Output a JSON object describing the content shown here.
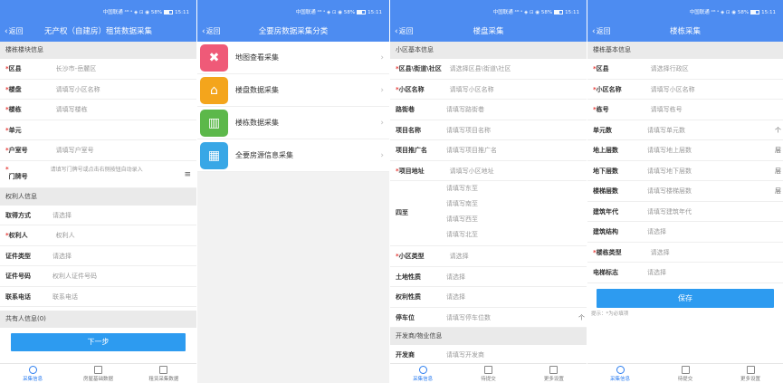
{
  "colors": {
    "header": "#4d8cf1",
    "button": "#2d9bf0",
    "section_bg": "#eaeaea",
    "required": "#e53935"
  },
  "status_text": "中国联通 ⁴ᴳ ᵃ ◈ ⊡ ◉ 58%",
  "status_time": "15:11",
  "screen1": {
    "back": "返回",
    "title": "无产权（自建房）租赁数据采集",
    "sec1": "楼栋楼块信息",
    "rows": [
      {
        "req": "*",
        "label": "区县",
        "value": "长沙市-岳麓区"
      },
      {
        "req": "*",
        "label": "楼盘",
        "value": "请填写小区名称"
      },
      {
        "req": "*",
        "label": "楼栋",
        "value": "请填写楼栋"
      },
      {
        "req": "*",
        "label": "单元",
        "value": ""
      },
      {
        "req": "*",
        "label": "户室号",
        "value": "请填写户室号"
      }
    ],
    "door_req": "*",
    "door_label": "门牌号",
    "door_value": "请填写门牌号或点击右侧按钮自动录入",
    "sec2": "权利人信息",
    "rows2": [
      {
        "req": "",
        "label": "取得方式",
        "value": "请选择"
      },
      {
        "req": "*",
        "label": "权利人",
        "value": "权利人"
      },
      {
        "req": "",
        "label": "证件类型",
        "value": "请选择"
      },
      {
        "req": "",
        "label": "证件号码",
        "value": "权利人证件号码"
      },
      {
        "req": "",
        "label": "联系电话",
        "value": "联系电话"
      }
    ],
    "sec3": "共有人信息(0)",
    "next": "下一步",
    "tabs": [
      "采集信息",
      "房屋基础数据",
      "租赁采集数据"
    ]
  },
  "screen2": {
    "back": "返回",
    "title": "全要房数据采集分类",
    "items": [
      {
        "label": "地图查看采集",
        "icon": "map-view-icon",
        "color": "#ef5a78",
        "glyph": "✖"
      },
      {
        "label": "楼盘数据采集",
        "icon": "house-icon",
        "color": "#f4a51c",
        "glyph": "⌂"
      },
      {
        "label": "楼栋数据采集",
        "icon": "map-book-icon",
        "color": "#5cb84a",
        "glyph": "▥"
      },
      {
        "label": "全要房源信息采集",
        "icon": "building-icon",
        "color": "#38a7e6",
        "glyph": "▦"
      }
    ]
  },
  "screen3": {
    "back": "返回",
    "title": "楼盘采集",
    "sec1": "小区基本信息",
    "rows": [
      {
        "req": "*",
        "label": "区县\\街道\\社区",
        "value": "请选择区县\\街道\\社区"
      },
      {
        "req": "*",
        "label": "小区名称",
        "value": "请填写小区名称"
      },
      {
        "req": "",
        "label": "路街巷",
        "value": "请填写路街巷"
      },
      {
        "req": "",
        "label": "项目名称",
        "value": "请填写项目名称"
      },
      {
        "req": "",
        "label": "项目推广名",
        "value": "请填写项目推广名"
      },
      {
        "req": "*",
        "label": "项目地址",
        "value": "请填写小区地址"
      }
    ],
    "four_label": "四至",
    "four": [
      "请填写东至",
      "请填写南至",
      "请填写西至",
      "请填写北至"
    ],
    "rows2": [
      {
        "req": "*",
        "label": "小区类型",
        "value": "请选择"
      },
      {
        "req": "",
        "label": "土地性质",
        "value": "请选择"
      },
      {
        "req": "",
        "label": "权利性质",
        "value": "请选择"
      },
      {
        "req": "",
        "label": "停车位",
        "value": "请填写停车位数"
      }
    ],
    "parking_unit": "个",
    "sec2": "开发商/物业信息",
    "row_dev": {
      "req": "",
      "label": "开发商",
      "value": "请填写开发商"
    },
    "tabs": [
      "采集信息",
      "待提交",
      "更多设置"
    ]
  },
  "screen4": {
    "back": "返回",
    "title": "楼栋采集",
    "sec1": "楼栋基本信息",
    "rows": [
      {
        "req": "*",
        "label": "区县",
        "value": "请选择行政区",
        "side": ""
      },
      {
        "req": "*",
        "label": "小区名称",
        "value": "请填写小区名称",
        "side": ""
      },
      {
        "req": "*",
        "label": "栋号",
        "value": "请填写栋号",
        "side": ""
      },
      {
        "req": "",
        "label": "单元数",
        "value": "请填写单元数",
        "side": "个"
      },
      {
        "req": "",
        "label": "地上层数",
        "value": "请填写地上层数",
        "side": "层"
      },
      {
        "req": "",
        "label": "地下层数",
        "value": "请填写地下层数",
        "side": "层"
      },
      {
        "req": "",
        "label": "楼梯层数",
        "value": "请填写楼梯层数",
        "side": "层"
      },
      {
        "req": "",
        "label": "建筑年代",
        "value": "请填写建筑年代",
        "side": ""
      },
      {
        "req": "",
        "label": "建筑结构",
        "value": "请选择",
        "side": ""
      },
      {
        "req": "*",
        "label": "楼栋类型",
        "value": "请选择",
        "side": ""
      },
      {
        "req": "",
        "label": "电梯标志",
        "value": "请选择",
        "side": ""
      }
    ],
    "save": "保存",
    "hint": "提示：*为必填项",
    "tabs": [
      "采集信息",
      "待提交",
      "更多设置"
    ]
  }
}
